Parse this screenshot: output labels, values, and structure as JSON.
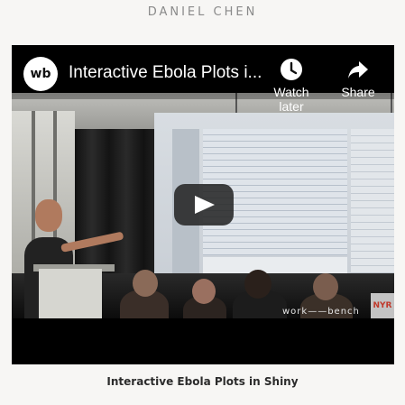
{
  "header": {
    "author": "DANIEL CHEN"
  },
  "video": {
    "title": "Interactive Ebola Plots i...",
    "channel_logo_text": "wb",
    "watch_later_label": "Watch later",
    "share_label": "Share",
    "watermark_text": "work——bench",
    "corner_badge_text": "NYR"
  },
  "caption": "Interactive Ebola Plots in Shiny",
  "colors": {
    "background": "#f7f6f4",
    "player": "#000000",
    "text": "#2b2b2b",
    "author": "#8a8a8a"
  },
  "icons": {
    "watch_later": "clock-icon",
    "share": "share-arrow-icon",
    "play": "play-icon"
  }
}
